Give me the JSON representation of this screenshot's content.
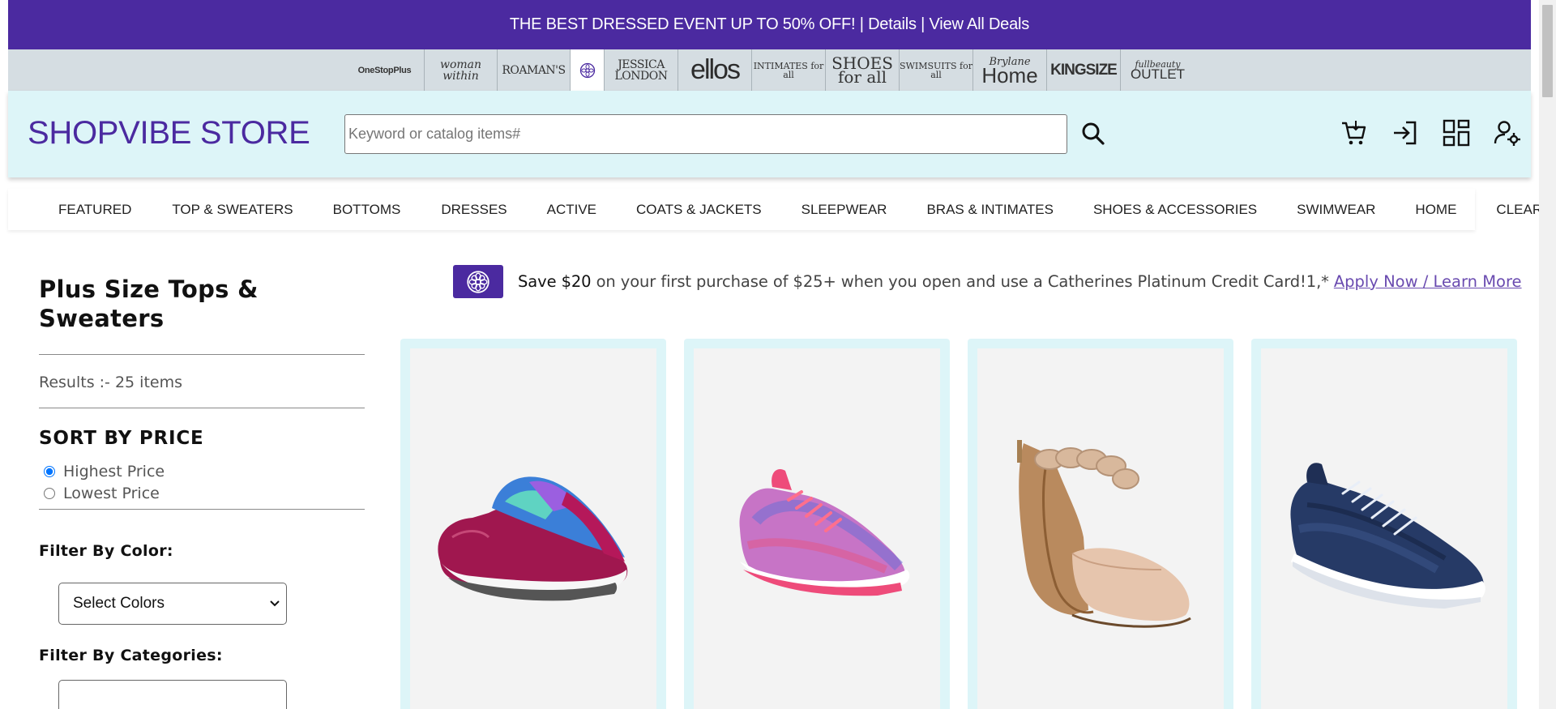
{
  "promo": {
    "text": "THE BEST DRESSED EVENT UP TO 50% OFF!",
    "separator": " | ",
    "details_link": "Details",
    "deals_link": "View All Deals"
  },
  "brands": {
    "onestop": "OneStopPlus",
    "woman_within": "woman within",
    "roamans": "ROAMAN'S",
    "catherines_logo": "catherines-flower-logo",
    "jessica_london": "JESSICA LONDON",
    "ellos": "ellos",
    "intimates": "INTIMATES for all",
    "shoes": "SHOES for all",
    "swimsuits": "SWIMSUITS for all",
    "brylane_script": "Brylane",
    "brylane_home": "Home",
    "kingsize": "KINGSIZE",
    "fullbeauty_script": "fullbeauty",
    "fullbeauty_outlet": "OUTLET"
  },
  "header": {
    "store_name": "SHOPVIBE STORE",
    "search_placeholder": "Keyword or catalog items#",
    "icons": [
      "search-icon",
      "cart-icon",
      "sign-in-icon",
      "dashboard-icon",
      "account-settings-icon"
    ]
  },
  "nav": {
    "items": [
      "FEATURED",
      "TOP & SWEATERS",
      "BOTTOMS",
      "DRESSES",
      "ACTIVE",
      "COATS & JACKETS",
      "SLEEPWEAR",
      "BRAS & INTIMATES",
      "SHOES & ACCESSORIES",
      "SWIMWEAR",
      "HOME",
      "CLEARANCE"
    ]
  },
  "sidebar": {
    "title": "Plus Size Tops & Sweaters",
    "results": "Results :- 25 items",
    "sort_heading": "SORT BY PRICE",
    "sort_options": [
      "Highest Price",
      "Lowest Price"
    ],
    "sort_selected": "Highest Price",
    "color_label": "Filter By Color:",
    "color_select": "Select Colors",
    "categories_label": "Filter By Categories:"
  },
  "credit_banner": {
    "bold": "Save $20",
    "text": " on your first purchase of $25+ when you open and use a Catherines Platinum Credit Card!1,*",
    "link": "Apply Now / Learn More"
  },
  "products": [
    {
      "image": "magenta-floral-slip-on-clog-sneaker"
    },
    {
      "image": "pink-knit-slip-on-sneaker"
    },
    {
      "image": "tan-braided-ankle-strap-flat"
    },
    {
      "image": "navy-knit-slip-on-sneaker"
    }
  ],
  "colors": {
    "brand_purple": "#4b2aa0",
    "header_bg": "#ddf5f8",
    "brand_bar_bg": "#d5dde2",
    "link_purple": "#6a4bb0"
  }
}
